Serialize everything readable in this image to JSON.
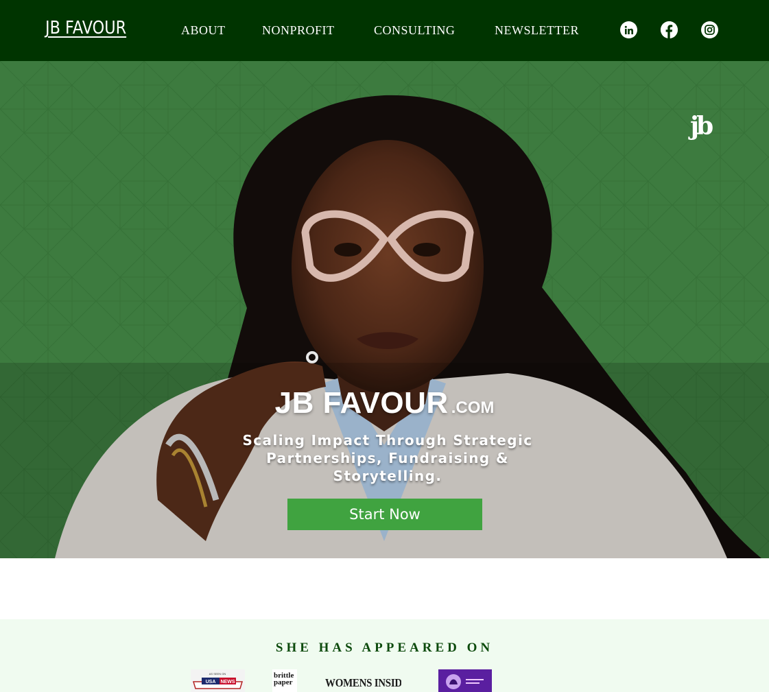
{
  "header": {
    "logo": "JB FAVOUR",
    "nav": [
      "ABOUT",
      "NONPROFIT",
      "CONSULTING",
      "NEWSLETTER"
    ],
    "social_icons": [
      "linkedin-icon",
      "facebook-icon",
      "instagram-icon"
    ]
  },
  "hero": {
    "brand_mark": "jb",
    "title": "JB FAVOUR",
    "title_suffix": ".COM",
    "tagline": "Scaling Impact Through Strategic Partnerships, Fundraising & Storytelling.",
    "cta_label": "Start Now"
  },
  "appeared_on": {
    "heading": "SHE HAS APPEARED ON",
    "logos": [
      {
        "name": "USA News",
        "lines": [
          "AS SEEN ON",
          "USA",
          "NEWS"
        ]
      },
      {
        "name": "brittle paper",
        "lines": [
          "brittle",
          "paper"
        ]
      },
      {
        "name": "Womens Insider",
        "lines": [
          "WOMENS INSIDER"
        ]
      },
      {
        "name": "purple lion logo",
        "lines": []
      }
    ]
  },
  "colors": {
    "header_bg": "#003400",
    "hero_green": "#3a7a3c",
    "cta_green": "#40a340",
    "section_bg": "#f0fbf0",
    "heading_green": "#0c4a0c"
  }
}
